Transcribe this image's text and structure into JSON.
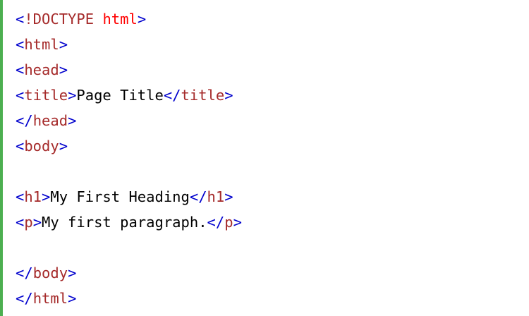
{
  "colors": {
    "bracket": "#0000cd",
    "tag": "#a52a2a",
    "doctype_name": "#ff0000",
    "text": "#000000",
    "accent_border": "#4caf50"
  },
  "code": {
    "lines": [
      [
        {
          "t": "<",
          "c": "bracket"
        },
        {
          "t": "!DOCTYPE",
          "c": "tag"
        },
        {
          "t": " ",
          "c": "text"
        },
        {
          "t": "html",
          "c": "doctype_name"
        },
        {
          "t": ">",
          "c": "bracket"
        }
      ],
      [
        {
          "t": "<",
          "c": "bracket"
        },
        {
          "t": "html",
          "c": "tag"
        },
        {
          "t": ">",
          "c": "bracket"
        }
      ],
      [
        {
          "t": "<",
          "c": "bracket"
        },
        {
          "t": "head",
          "c": "tag"
        },
        {
          "t": ">",
          "c": "bracket"
        }
      ],
      [
        {
          "t": "<",
          "c": "bracket"
        },
        {
          "t": "title",
          "c": "tag"
        },
        {
          "t": ">",
          "c": "bracket"
        },
        {
          "t": "Page Title",
          "c": "text"
        },
        {
          "t": "</",
          "c": "bracket"
        },
        {
          "t": "title",
          "c": "tag"
        },
        {
          "t": ">",
          "c": "bracket"
        }
      ],
      [
        {
          "t": "</",
          "c": "bracket"
        },
        {
          "t": "head",
          "c": "tag"
        },
        {
          "t": ">",
          "c": "bracket"
        }
      ],
      [
        {
          "t": "<",
          "c": "bracket"
        },
        {
          "t": "body",
          "c": "tag"
        },
        {
          "t": ">",
          "c": "bracket"
        }
      ],
      [],
      [
        {
          "t": "<",
          "c": "bracket"
        },
        {
          "t": "h1",
          "c": "tag"
        },
        {
          "t": ">",
          "c": "bracket"
        },
        {
          "t": "My First Heading",
          "c": "text"
        },
        {
          "t": "</",
          "c": "bracket"
        },
        {
          "t": "h1",
          "c": "tag"
        },
        {
          "t": ">",
          "c": "bracket"
        }
      ],
      [
        {
          "t": "<",
          "c": "bracket"
        },
        {
          "t": "p",
          "c": "tag"
        },
        {
          "t": ">",
          "c": "bracket"
        },
        {
          "t": "My first paragraph.",
          "c": "text"
        },
        {
          "t": "</",
          "c": "bracket"
        },
        {
          "t": "p",
          "c": "tag"
        },
        {
          "t": ">",
          "c": "bracket"
        }
      ],
      [],
      [
        {
          "t": "</",
          "c": "bracket"
        },
        {
          "t": "body",
          "c": "tag"
        },
        {
          "t": ">",
          "c": "bracket"
        }
      ],
      [
        {
          "t": "</",
          "c": "bracket"
        },
        {
          "t": "html",
          "c": "tag"
        },
        {
          "t": ">",
          "c": "bracket"
        }
      ]
    ]
  }
}
